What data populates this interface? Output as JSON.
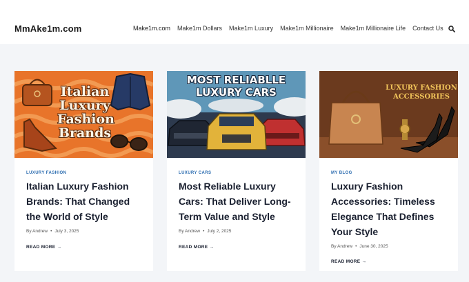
{
  "site": {
    "logo": "MmAke1m.com"
  },
  "nav": {
    "items": [
      "Make1m.com",
      "Make1m Dollars",
      "Make1m Luxury",
      "Make1m Millionaire",
      "Make1m Millionaire Life",
      "Contact Us"
    ],
    "search_icon": "search-icon"
  },
  "cards": [
    {
      "image_text": [
        "Italian",
        "Luxury",
        "Fashion",
        "Brands"
      ],
      "category": "LUXURY FASHION",
      "title": "Italian Luxury Fashion Brands: That Changed the World of Style",
      "author": "By Andrew",
      "date": "July 3, 2025",
      "read_more": "READ MORE →"
    },
    {
      "image_text": [
        "MOST RELIABLLE",
        "LUXURY CARS"
      ],
      "category": "LUXURY CARS",
      "title": "Most Reliable Luxury Cars: That Deliver Long-Term Value and Style",
      "author": "By Andrew",
      "date": "July 2, 2025",
      "read_more": "READ MORE →"
    },
    {
      "image_text": [
        "LUXURY FASHION",
        "ACCESSORIES"
      ],
      "category": "MY BLOG",
      "title": "Luxury Fashion Accessories: Timeless Elegance That Defines Your Style",
      "author": "By Andrew",
      "date": "June 30, 2025",
      "read_more": "READ MORE →"
    }
  ],
  "colors": {
    "accent": "#2b6cb0",
    "background": "#f3f5f8"
  }
}
